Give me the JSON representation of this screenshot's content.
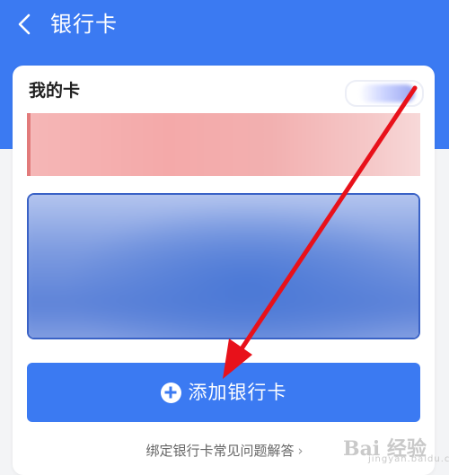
{
  "header": {
    "title": "银行卡",
    "back_icon": "chevron-left-icon",
    "background_color": "#3b7af2"
  },
  "my_cards": {
    "section_title": "我的卡"
  },
  "add_button": {
    "label": "添加银行卡",
    "icon": "plus-circle-icon",
    "color": "#3b7af2"
  },
  "faq": {
    "label": "绑定银行卡常见问题解答",
    "icon": "chevron-right-icon"
  },
  "annotation": {
    "arrow_color": "#e8111a"
  },
  "watermark": {
    "text": "Bai 经验",
    "sub": "jingyan.baidu.com"
  }
}
